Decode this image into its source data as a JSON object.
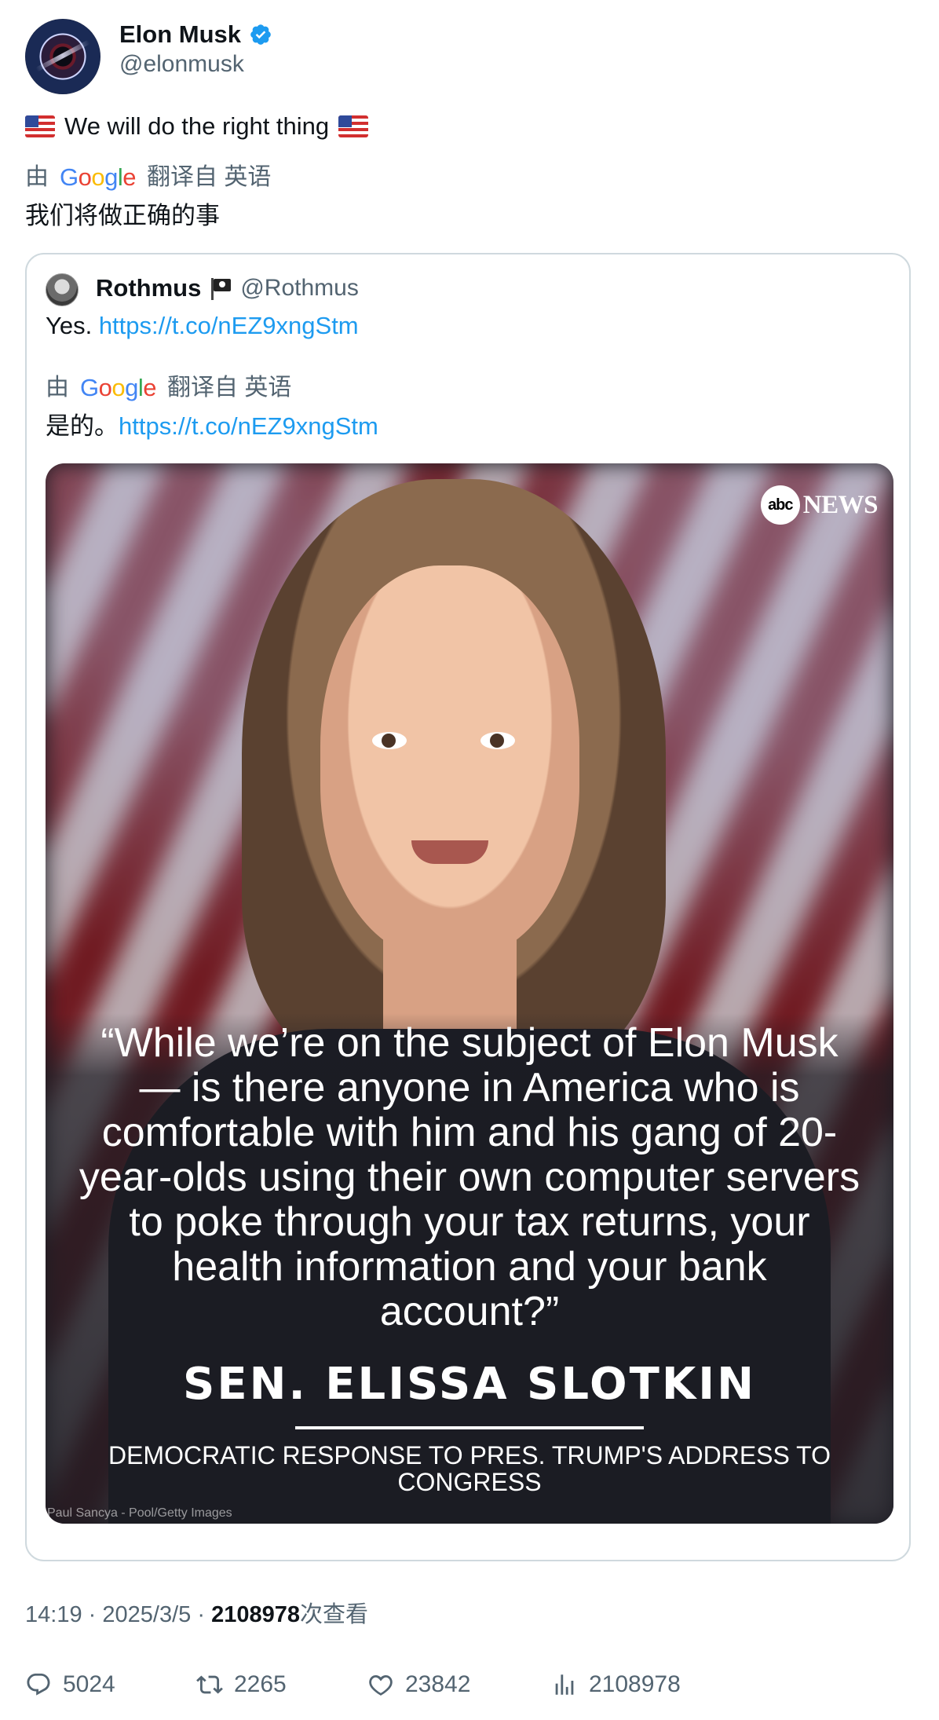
{
  "author": {
    "name": "Elon Musk",
    "handle": "@elonmusk",
    "verified": true
  },
  "tweet": {
    "text": "We will do the right thing",
    "translate_prefix": "由",
    "translate_logo": "Google",
    "translate_suffix": "翻译自 英语",
    "translated_text": "我们将做正确的事"
  },
  "quoted": {
    "name": "Rothmus",
    "handle": "@Rothmus",
    "text_prefix": "Yes.",
    "link": "https://t.co/nEZ9xngStm",
    "translate_prefix": "由",
    "translate_logo": "Google",
    "translate_suffix": "翻译自 英语",
    "translated_prefix": "是的。",
    "translated_link": "https://t.co/nEZ9xngStm",
    "image": {
      "brand": "NEWS",
      "brand_mark": "abc",
      "quote": "“While we’re on the subject of Elon Musk — is there anyone in America who is comfortable with him and his gang of 20-year-olds using their own computer servers to poke through your tax returns, your health information and your bank account?”",
      "speaker": "SEN. ELISSA SLOTKIN",
      "subtitle": "DEMOCRATIC RESPONSE TO PRES. TRUMP'S ADDRESS TO CONGRESS",
      "credit": "Paul Sancya - Pool/Getty Images"
    }
  },
  "meta": {
    "time": "14:19",
    "date": "2025/3/5",
    "views": "2108978",
    "views_label": "次查看",
    "sep": "·"
  },
  "stats": {
    "replies": "5024",
    "retweets": "2265",
    "likes": "23842",
    "views": "2108978"
  },
  "colors": {
    "link": "#1d9bf0",
    "secondary": "#536471",
    "verified": "#1d9bf0"
  }
}
